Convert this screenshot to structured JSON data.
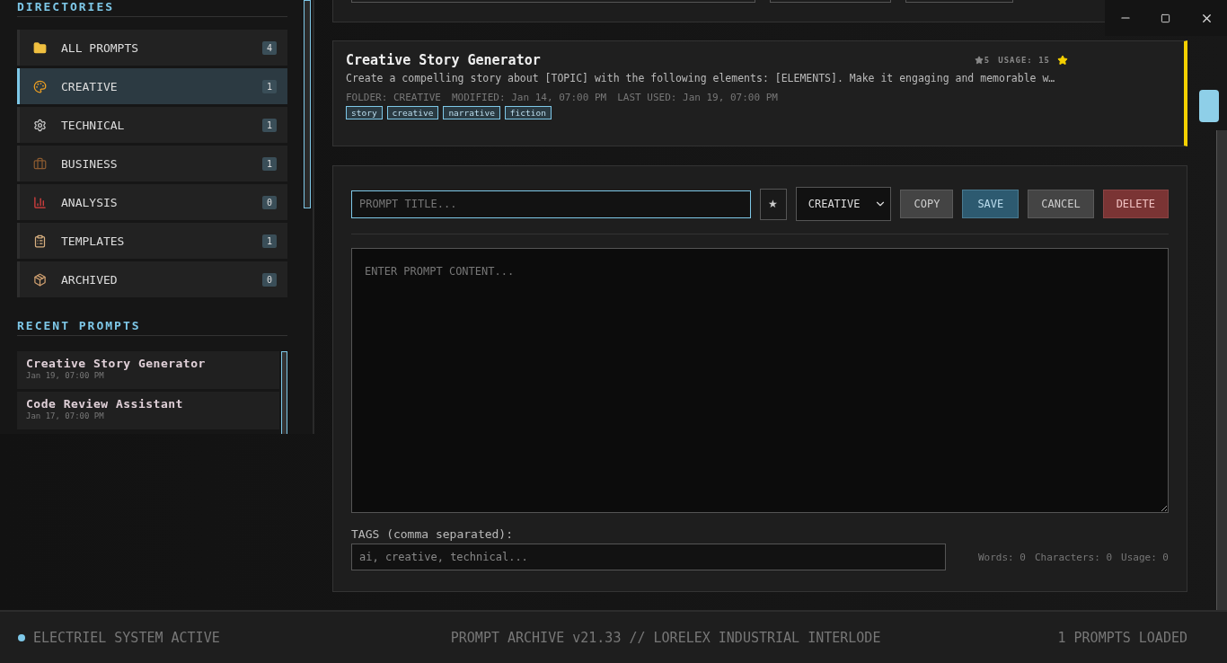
{
  "sidebar": {
    "directories_title": "DIRECTORIES",
    "directories": [
      {
        "label": "ALL PROMPTS",
        "count": "4",
        "selected": false
      },
      {
        "label": "CREATIVE",
        "count": "1",
        "selected": true
      },
      {
        "label": "TECHNICAL",
        "count": "1",
        "selected": false
      },
      {
        "label": "BUSINESS",
        "count": "1",
        "selected": false
      },
      {
        "label": "ANALYSIS",
        "count": "0",
        "selected": false
      },
      {
        "label": "TEMPLATES",
        "count": "1",
        "selected": false
      },
      {
        "label": "ARCHIVED",
        "count": "0",
        "selected": false
      }
    ],
    "recent_title": "RECENT PROMPTS",
    "recent": [
      {
        "title": "Creative Story Generator",
        "date": "Jan 19, 07:00 PM"
      },
      {
        "title": "Code Review Assistant",
        "date": "Jan 17, 07:00 PM"
      }
    ]
  },
  "prompt_card": {
    "title": "Creative Story Generator",
    "rating": "5",
    "usage": "USAGE: 15",
    "favorite": true,
    "content": "Create a compelling story about [TOPIC] with the following elements: [ELEMENTS]. Make it engaging and memorable w…",
    "meta": [
      "FOLDER: CREATIVE",
      "MODIFIED: Jan 14, 07:00 PM",
      "LAST USED: Jan 19, 07:00 PM"
    ],
    "tags": [
      "story",
      "creative",
      "narrative",
      "fiction"
    ]
  },
  "editor": {
    "title_placeholder": "PROMPT TITLE...",
    "favorite_button": "★",
    "folder": "CREATIVE",
    "buttons": [
      {
        "label": "COPY",
        "kind": "neutral"
      },
      {
        "label": "SAVE",
        "kind": "primary"
      },
      {
        "label": "CANCEL",
        "kind": "neutral"
      },
      {
        "label": "DELETE",
        "kind": "danger"
      }
    ],
    "content_placeholder": "ENTER PROMPT CONTENT...",
    "tags_label": "TAGS (comma separated):",
    "tags_placeholder": "ai, creative, technical...",
    "stats": [
      "Words: 0",
      "Characters: 0",
      "Usage: 0"
    ]
  },
  "status_bar": {
    "status": "ELECTRIEL SYSTEM ACTIVE",
    "active": true,
    "center": "PROMPT ARCHIVE v21.33 // LORELEX INDUSTRIAL INTERLODE",
    "right": "1 PROMPTS LOADED"
  }
}
